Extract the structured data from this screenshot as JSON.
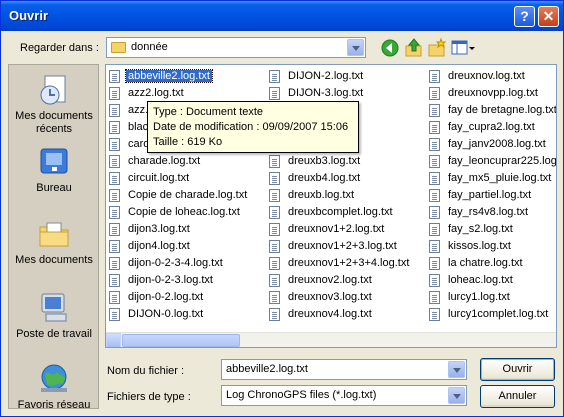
{
  "window": {
    "title": "Ouvrir",
    "help_icon": "question-mark",
    "close_icon": "x-close"
  },
  "look_in": {
    "label": "Regarder dans :",
    "value": "donnée"
  },
  "toolbar": {
    "back": "back-arrow-icon",
    "up": "up-folder-icon",
    "new_folder": "new-folder-icon",
    "view": "view-menu-icon"
  },
  "places": [
    {
      "label": "Mes documents récents",
      "icon": "recent-documents-icon"
    },
    {
      "label": "Bureau",
      "icon": "desktop-icon"
    },
    {
      "label": "Mes documents",
      "icon": "my-documents-icon"
    },
    {
      "label": "Poste de travail",
      "icon": "my-computer-icon"
    },
    {
      "label": "Favoris réseau",
      "icon": "network-places-icon"
    }
  ],
  "files": {
    "col1": [
      "abbeville2.log.txt",
      "azz2.log.txt",
      "azz.l",
      "black",
      "caro",
      "charade.log.txt",
      "circuit.log.txt",
      "Copie de charade.log.txt",
      "Copie de loheac.log.txt",
      "dijon3.log.txt",
      "dijon4.log.txt",
      "dijon-0-2-3-4.log.txt",
      "dijon-0-2-3.log.txt",
      "dijon-0-2.log.txt",
      "DIJON-0.log.txt"
    ],
    "col2": [
      "DIJON-2.log.txt",
      "DIJON-3.log.txt",
      "",
      "",
      "",
      "dreuxb3.log.txt",
      "dreuxb4.log.txt",
      "dreuxb.log.txt",
      "dreuxbcomplet.log.txt",
      "dreuxnov1+2.log.txt",
      "dreuxnov1+2+3.log.txt",
      "dreuxnov1+2+3+4.log.txt",
      "dreuxnov2.log.txt",
      "dreuxnov3.log.txt",
      "dreuxnov4.log.txt"
    ],
    "col3": [
      "dreuxnov.log.txt",
      "dreuxnovpp.log.txt",
      "fay de bretagne.log.txt",
      "fay_cupra2.log.txt",
      "fay_janv2008.log.txt",
      "fay_leoncuprar225.log",
      "fay_mx5_pluie.log.txt",
      "fay_partiel.log.txt",
      "fay_rs4v8.log.txt",
      "fay_s2.log.txt",
      "kissos.log.txt",
      "la chatre.log.txt",
      "loheac.log.txt",
      "lurcy1.log.txt",
      "lurcy1complet.log.txt"
    ]
  },
  "selected_file": "abbeville2.log.txt",
  "tooltip": {
    "type": "Type : Document texte",
    "modified": "Date de modification : 09/09/2007 15:06",
    "size": "Taille  : 619 Ko"
  },
  "filename": {
    "label": "Nom du fichier :",
    "value": "abbeville2.log.txt"
  },
  "filetype": {
    "label": "Fichiers de type :",
    "value": "Log ChronoGPS files (*.log.txt)"
  },
  "buttons": {
    "open": "Ouvrir",
    "cancel": "Annuler"
  }
}
